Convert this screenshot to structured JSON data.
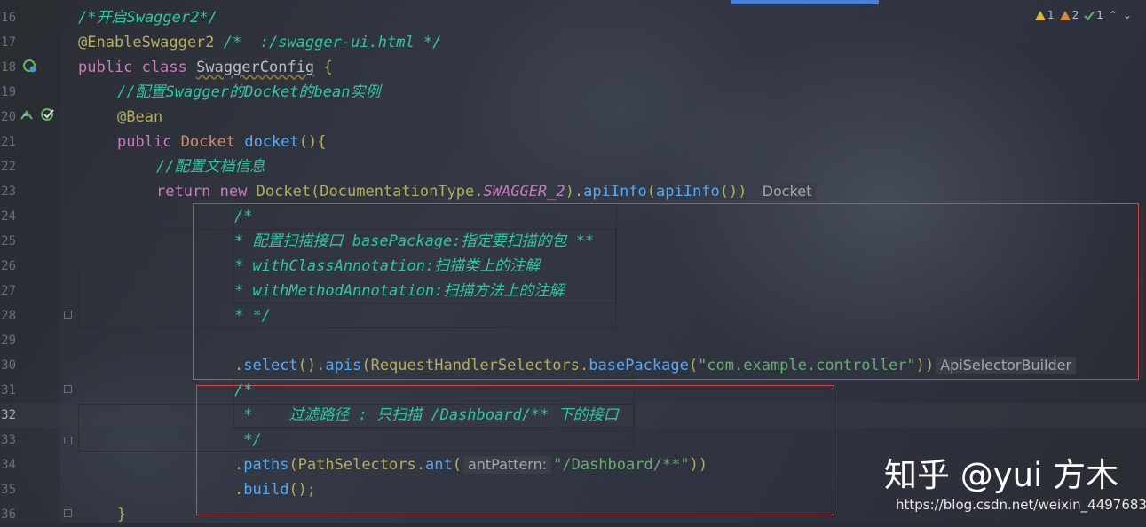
{
  "editor": {
    "language": "Java",
    "current_line": 32,
    "line_numbers": [
      "16",
      "17",
      "18",
      "19",
      "20",
      "21",
      "22",
      "23",
      "24",
      "25",
      "26",
      "27",
      "28",
      "29",
      "30",
      "31",
      "32",
      "33",
      "34",
      "35",
      "36"
    ],
    "lines": {
      "l16": {
        "comment": "/*开启Swagger2*/"
      },
      "l17": {
        "annotation": "@EnableSwagger2",
        "comment": "/*  :/swagger-ui.html */"
      },
      "l18": {
        "kw_public": "public",
        "kw_class": "class",
        "class_name": "SwaggerConfig",
        "brace": "{"
      },
      "l19": {
        "comment": "//配置Swagger的Docket的bean实例"
      },
      "l20": {
        "annotation": "@Bean"
      },
      "l21": {
        "kw_public": "public",
        "type": "Docket",
        "method": "docket",
        "rest": "(){"
      },
      "l22": {
        "comment": "//配置文档信息"
      },
      "l23": {
        "kw_return": "return",
        "kw_new": "new",
        "ctor": "Docket(DocumentationType.",
        "const": "SWAGGER_2",
        "close": ").",
        "method1": "apiInfo",
        "paren": "(",
        "method2": "apiInfo",
        "end": "())",
        "hint": "Docket"
      },
      "l24": {
        "comment": "/*"
      },
      "l25": {
        "comment": "* 配置扫描接口 basePackage:指定要扫描的包 **"
      },
      "l26": {
        "comment": "* withClassAnnotation:扫描类上的注解"
      },
      "l27": {
        "comment": "* withMethodAnnotation:扫描方法上的注解"
      },
      "l28": {
        "comment": "* */"
      },
      "l30": {
        "dot": ".",
        "select": "select",
        "mid": "().",
        "apis": "apis",
        "open": "(RequestHandlerSelectors.",
        "basePackage": "basePackage",
        "paren": "(",
        "string": "\"com.example.controller\"",
        "close": "))",
        "hint": "ApiSelectorBuilder"
      },
      "l31": {
        "comment": "/*"
      },
      "l32": {
        "comment": " *    过滤路径 : 只扫描 /Dashboard/** 下的接口"
      },
      "l33": {
        "comment": " */"
      },
      "l34": {
        "dot": ".",
        "paths": "paths",
        "open": "(PathSelectors.",
        "ant": "ant",
        "paren": "(",
        "param_hint": "antPattern:",
        "string": "\"/Dashboard/**\"",
        "close": "))"
      },
      "l35": {
        "dot": ".",
        "build": "build",
        "close": "();"
      },
      "l36": {
        "brace": "}"
      }
    }
  },
  "inspections": {
    "warnings": "1",
    "weak_warnings": "2",
    "ok": "1",
    "up": "⌃",
    "down": "⌄"
  },
  "watermark": {
    "text": "知乎 @yui 方木",
    "url": "https://blog.csdn.net/weixin_44976835"
  },
  "colors": {
    "annotation_box": "#d04848",
    "comment": "#2fc5a5",
    "keyword": "#cf8e6d"
  }
}
